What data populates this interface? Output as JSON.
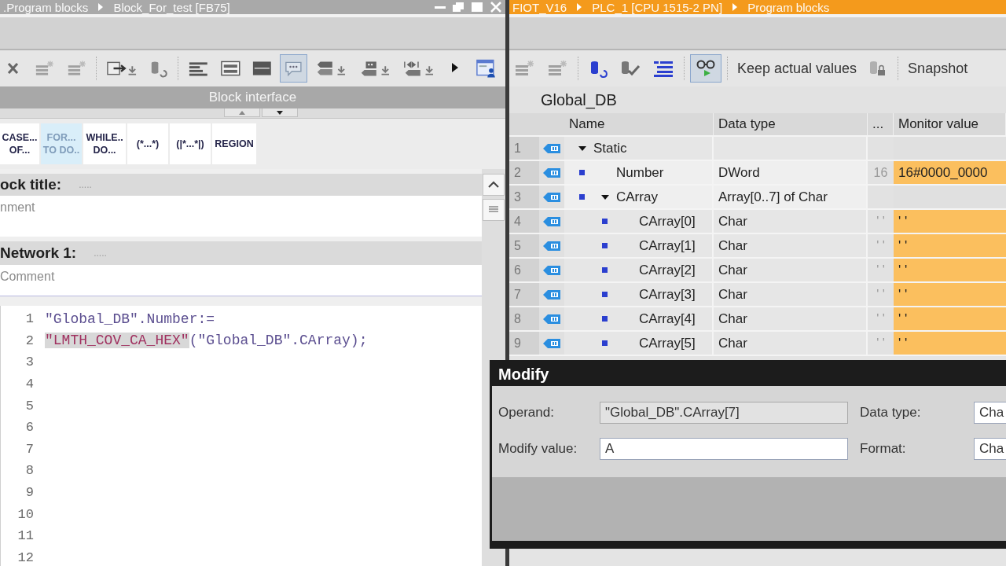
{
  "editor_window": {
    "breadcrumb": [
      ".Program blocks",
      "Block_For_test [FB75]"
    ],
    "toolbar": [
      {
        "selected": false
      },
      {
        "selected": false
      },
      {
        "selected": false
      },
      {
        "selected": false
      },
      {
        "selected": false
      },
      {
        "selected": false
      },
      {
        "selected": false
      },
      {
        "selected": false
      },
      {
        "selected": true
      },
      {
        "selected": false
      },
      {
        "selected": false
      },
      {
        "selected": false
      },
      {
        "selected": false
      },
      {
        "selected": false
      }
    ],
    "section_bar": "Block interface",
    "instructions": [
      {
        "lines": [
          "CASE...",
          "OF..."
        ],
        "selected": false
      },
      {
        "lines": [
          "FOR...",
          "TO DO.."
        ],
        "selected": true
      },
      {
        "lines": [
          "WHILE..",
          "DO..."
        ],
        "selected": false
      },
      {
        "lines": [
          "(*...*)"
        ],
        "selected": false
      },
      {
        "lines": [
          "(|*...*|)"
        ],
        "selected": false
      },
      {
        "lines": [
          "REGION"
        ],
        "selected": false
      }
    ],
    "block_title": {
      "label": "ock title:",
      "placeholder": "....."
    },
    "block_comment": "nment",
    "network": {
      "label": "Network 1:",
      "placeholder": "....."
    },
    "network_comment": "Comment",
    "code": [
      {
        "number": "1",
        "segments": [
          {
            "kind": "plain",
            "text": "\"Global_DB\".Number:="
          }
        ]
      },
      {
        "number": "2",
        "segments": [
          {
            "kind": "call",
            "text": "\"LMTH_COV_CA_HEX\""
          },
          {
            "kind": "plain",
            "text": "(\"Global_DB\".CArray);"
          }
        ]
      },
      {
        "number": "3"
      },
      {
        "number": "4"
      },
      {
        "number": "5"
      },
      {
        "number": "6"
      },
      {
        "number": "7"
      },
      {
        "number": "8"
      },
      {
        "number": "9"
      },
      {
        "number": "10"
      },
      {
        "number": "11"
      },
      {
        "number": "12"
      }
    ]
  },
  "monitor_window": {
    "breadcrumb": [
      "FIOT_V16",
      "PLC_1 [CPU 1515-2 PN]",
      "Program blocks"
    ],
    "toolbar": [
      {
        "kind": "icon",
        "selected": false
      },
      {
        "kind": "icon",
        "selected": false
      },
      {
        "kind": "icon",
        "selected": false
      },
      {
        "kind": "icon",
        "selected": false
      },
      {
        "kind": "icon",
        "selected": false
      },
      {
        "kind": "icon",
        "selected": true
      },
      {
        "kind": "text",
        "label": "Keep actual values",
        "selected": false
      },
      {
        "kind": "icon",
        "selected": false
      },
      {
        "kind": "text",
        "label": "Snapshot",
        "selected": false
      }
    ],
    "db_title": "Global_DB",
    "columns": [
      "Name",
      "Data type",
      "...",
      "Monitor value"
    ],
    "rows": [
      {
        "number": "1",
        "name": "Static",
        "expanded": true,
        "children": [
          {
            "number": "2",
            "name": "Number",
            "data_type": "DWord",
            "start_value": "16",
            "monitor_value": "16#0000_0000"
          },
          {
            "number": "3",
            "name": "CArray",
            "data_type": "Array[0..7] of Char",
            "expanded": true,
            "children": [
              {
                "number": "4",
                "name": "CArray[0]",
                "data_type": "Char",
                "start_value": "' '",
                "monitor_value": "' '"
              },
              {
                "number": "5",
                "name": "CArray[1]",
                "data_type": "Char",
                "start_value": "' '",
                "monitor_value": "' '"
              },
              {
                "number": "6",
                "name": "CArray[2]",
                "data_type": "Char",
                "start_value": "' '",
                "monitor_value": "' '"
              },
              {
                "number": "7",
                "name": "CArray[3]",
                "data_type": "Char",
                "start_value": "' '",
                "monitor_value": "' '"
              },
              {
                "number": "8",
                "name": "CArray[4]",
                "data_type": "Char",
                "start_value": "' '",
                "monitor_value": "' '"
              },
              {
                "number": "9",
                "name": "CArray[5]",
                "data_type": "Char",
                "start_value": "' '",
                "monitor_value": "' '"
              }
            ]
          }
        ]
      }
    ]
  },
  "modify_dialog": {
    "title": "Modify",
    "fields": [
      {
        "label": "Operand:",
        "value": "\"Global_DB\".CArray[7]",
        "readonly": true
      },
      {
        "label": "Data type:",
        "value": "Cha",
        "readonly": false
      },
      {
        "label": "Modify value:",
        "value": "A",
        "readonly": false
      },
      {
        "label": "Format:",
        "value": "Cha",
        "readonly": false
      }
    ]
  }
}
